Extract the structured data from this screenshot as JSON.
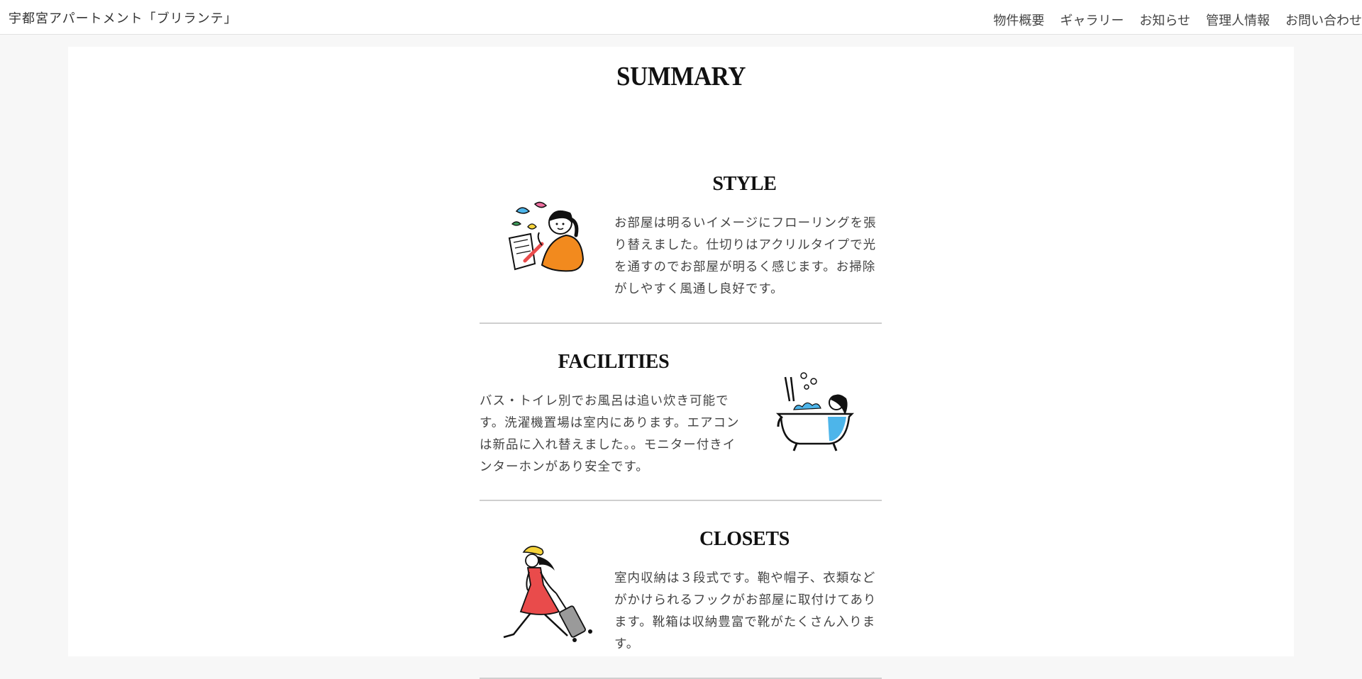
{
  "header": {
    "site_title": "宇都宮アパートメント「ブリランテ」",
    "nav": [
      "物件概要",
      "ギャラリー",
      "お知らせ",
      "管理人情報",
      "お問い合わせ"
    ]
  },
  "main": {
    "title": "SUMMARY",
    "sections": [
      {
        "heading": "STYLE",
        "text": "お部屋は明るいイメージにフローリングを張り替えました。仕切りはアクリルタイプで光を通すのでお部屋が明るく感じます。お掃除がしやすく風通し良好です。",
        "illustration": "woman-drawing-icon"
      },
      {
        "heading": "FACILITIES",
        "text": "バス・トイレ別でお風呂は追い炊き可能です。洗濯機置場は室内にあります。エアコンは新品に入れ替えました。。モニター付きインターホンがあり安全です。",
        "illustration": "woman-bathtub-icon"
      },
      {
        "heading": "CLOSETS",
        "text": "室内収納は３段式です。鞄や帽子、衣類などがかけられるフックがお部屋に取付けてあります。靴箱は収納豊富で靴がたくさん入ります。",
        "illustration": "woman-suitcase-icon"
      }
    ]
  },
  "colors": {
    "accent_orange": "#f28a1e",
    "accent_blue": "#4db5ea",
    "accent_red": "#e94b4b",
    "accent_yellow": "#f5d33a"
  }
}
